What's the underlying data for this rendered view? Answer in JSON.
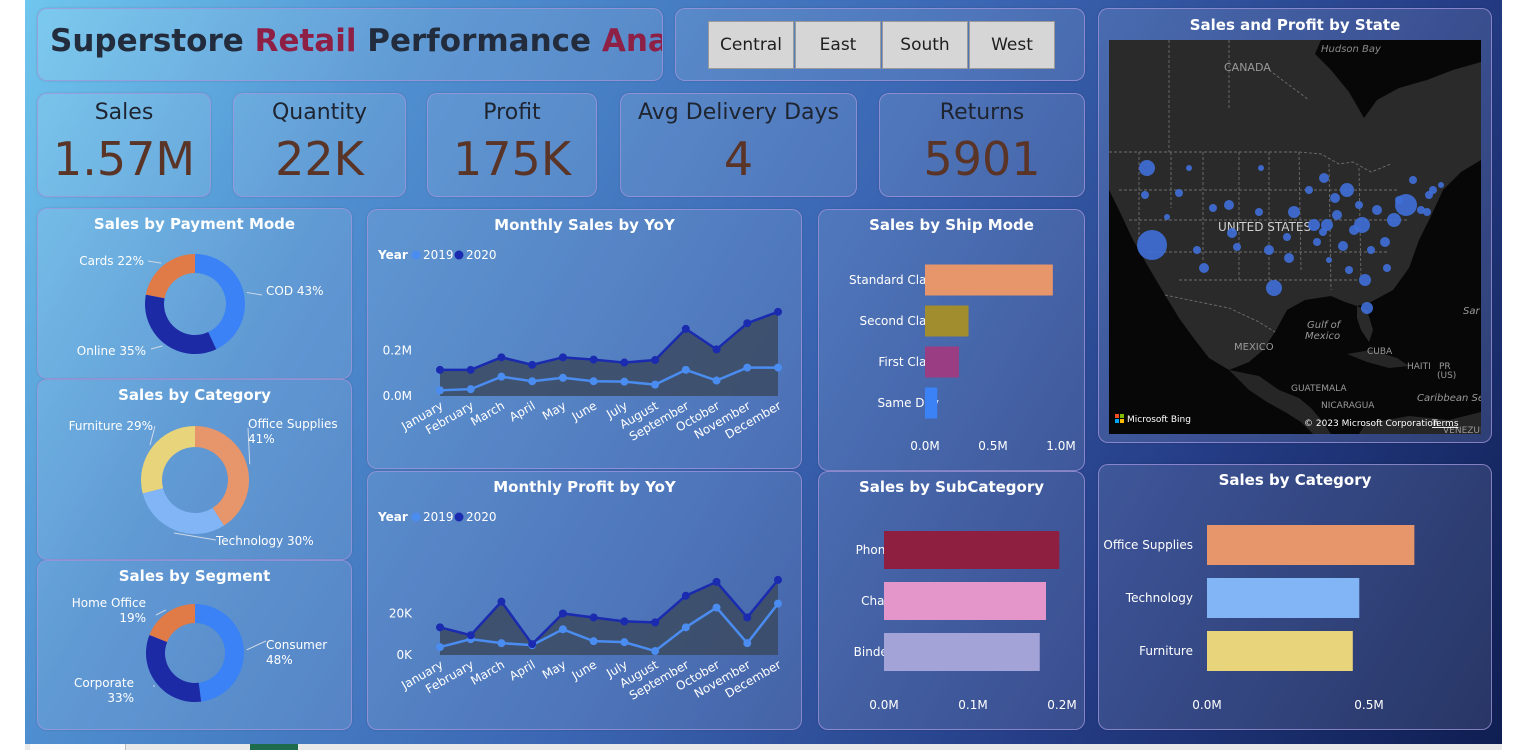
{
  "title": {
    "part1": "Superstore ",
    "part2": "Retail",
    "part3": " Performance ",
    "part4": "Analysis"
  },
  "regions": [
    "Central",
    "East",
    "South",
    "West"
  ],
  "kpis": [
    {
      "label": "Sales",
      "value": "1.57M"
    },
    {
      "label": "Quantity",
      "value": "22K"
    },
    {
      "label": "Profit",
      "value": "175K"
    },
    {
      "label": "Avg Delivery Days",
      "value": "4"
    },
    {
      "label": "Returns",
      "value": "5901"
    }
  ],
  "map": {
    "title": "Sales and Profit by State",
    "labels": [
      "Hudson Bay",
      "CANADA",
      "UNITED STATES",
      "Gulf of",
      "Mexico",
      "MEXICO",
      "CUBA",
      "HAITI",
      "PR",
      "(US)",
      "GUATEMALA",
      "NICARAGUA",
      "Caribbean Sea",
      "Sar",
      "VENEZUEL"
    ],
    "attribution": "Microsoft Bing",
    "copyright": "© 2023 Microsoft Corporation",
    "terms": "Terms"
  },
  "colors": {
    "y2019": "#4a8cf0",
    "y2020": "#1a2bb0",
    "area": "#3b4a62",
    "payment": [
      "#3b82f6",
      "#1d2aa6",
      "#e07a47"
    ],
    "category_donut": [
      "#e7956a",
      "#82b5f5",
      "#e8d47a"
    ],
    "segment": [
      "#3b82f6",
      "#1d2aa6",
      "#e07a47"
    ],
    "ship": [
      "#e7956a",
      "#a18c2e",
      "#9a3d82",
      "#3b82f6"
    ],
    "subcat": [
      "#8e1f40",
      "#e496cb",
      "#a3a3d8"
    ],
    "category_bar": [
      "#e7956a",
      "#82b5f5",
      "#e8d47a"
    ]
  },
  "chart_data": [
    {
      "type": "pie",
      "title": "Sales by Payment Mode",
      "labels": [
        "COD 43%",
        "Online 35%",
        "Cards 22%"
      ],
      "values": [
        43,
        35,
        22
      ]
    },
    {
      "type": "pie",
      "title": "Sales by Category",
      "labels": [
        "Office Supplies 41%",
        "Technology 30%",
        "Furniture 29%"
      ],
      "values": [
        41,
        30,
        29
      ]
    },
    {
      "type": "pie",
      "title": "Sales by Segment",
      "labels": [
        "Consumer 48%",
        "Corporate 33%",
        "Home Office 19%"
      ],
      "values": [
        48,
        33,
        19
      ]
    },
    {
      "type": "line",
      "title": "Monthly Sales by YoY",
      "legend_title": "Year",
      "x": [
        "January",
        "February",
        "March",
        "April",
        "May",
        "June",
        "July",
        "August",
        "September",
        "October",
        "November",
        "December"
      ],
      "series": [
        {
          "name": "2019",
          "values": [
            0.025,
            0.03,
            0.085,
            0.065,
            0.08,
            0.065,
            0.063,
            0.05,
            0.115,
            0.068,
            0.125,
            0.125
          ]
        },
        {
          "name": "2020",
          "values": [
            0.115,
            0.115,
            0.17,
            0.137,
            0.17,
            0.16,
            0.147,
            0.158,
            0.295,
            0.205,
            0.32,
            0.37
          ]
        }
      ],
      "yticks": [
        "0.0M",
        "0.2M"
      ],
      "ylim": [
        0,
        0.4
      ]
    },
    {
      "type": "line",
      "title": "Monthly Profit by YoY",
      "legend_title": "Year",
      "x": [
        "January",
        "February",
        "March",
        "April",
        "May",
        "June",
        "July",
        "August",
        "September",
        "October",
        "November",
        "December"
      ],
      "series": [
        {
          "name": "2019",
          "values": [
            4000,
            8000,
            6000,
            5000,
            13000,
            7000,
            6500,
            2000,
            14000,
            24000,
            6000,
            26000
          ]
        },
        {
          "name": "2020",
          "values": [
            14000,
            10000,
            27000,
            5500,
            21000,
            19000,
            17000,
            16500,
            30000,
            37000,
            19000,
            38000
          ]
        }
      ],
      "yticks": [
        "0K",
        "20K"
      ],
      "ylim": [
        0,
        42000
      ]
    },
    {
      "type": "bar",
      "title": "Sales by Ship Mode",
      "orientation": "horizontal",
      "categories": [
        "Standard Class",
        "Second Class",
        "First Class",
        "Same Day"
      ],
      "values": [
        0.94,
        0.32,
        0.25,
        0.09
      ],
      "xticks": [
        "0.0M",
        "0.5M",
        "1.0M"
      ],
      "xlim": [
        0,
        1.0
      ]
    },
    {
      "type": "bar",
      "title": "Sales by SubCategory",
      "orientation": "horizontal",
      "categories": [
        "Phones",
        "Chairs",
        "Binders"
      ],
      "values": [
        0.197,
        0.182,
        0.175
      ],
      "xticks": [
        "0.0M",
        "0.1M",
        "0.2M"
      ],
      "xlim": [
        0,
        0.2
      ]
    },
    {
      "type": "bar",
      "title": "Sales by Category",
      "orientation": "horizontal",
      "categories": [
        "Office Supplies",
        "Technology",
        "Furniture"
      ],
      "values": [
        0.64,
        0.47,
        0.45
      ],
      "xticks": [
        "0.0M",
        "0.5M"
      ],
      "xlim": [
        0,
        0.5
      ]
    }
  ]
}
